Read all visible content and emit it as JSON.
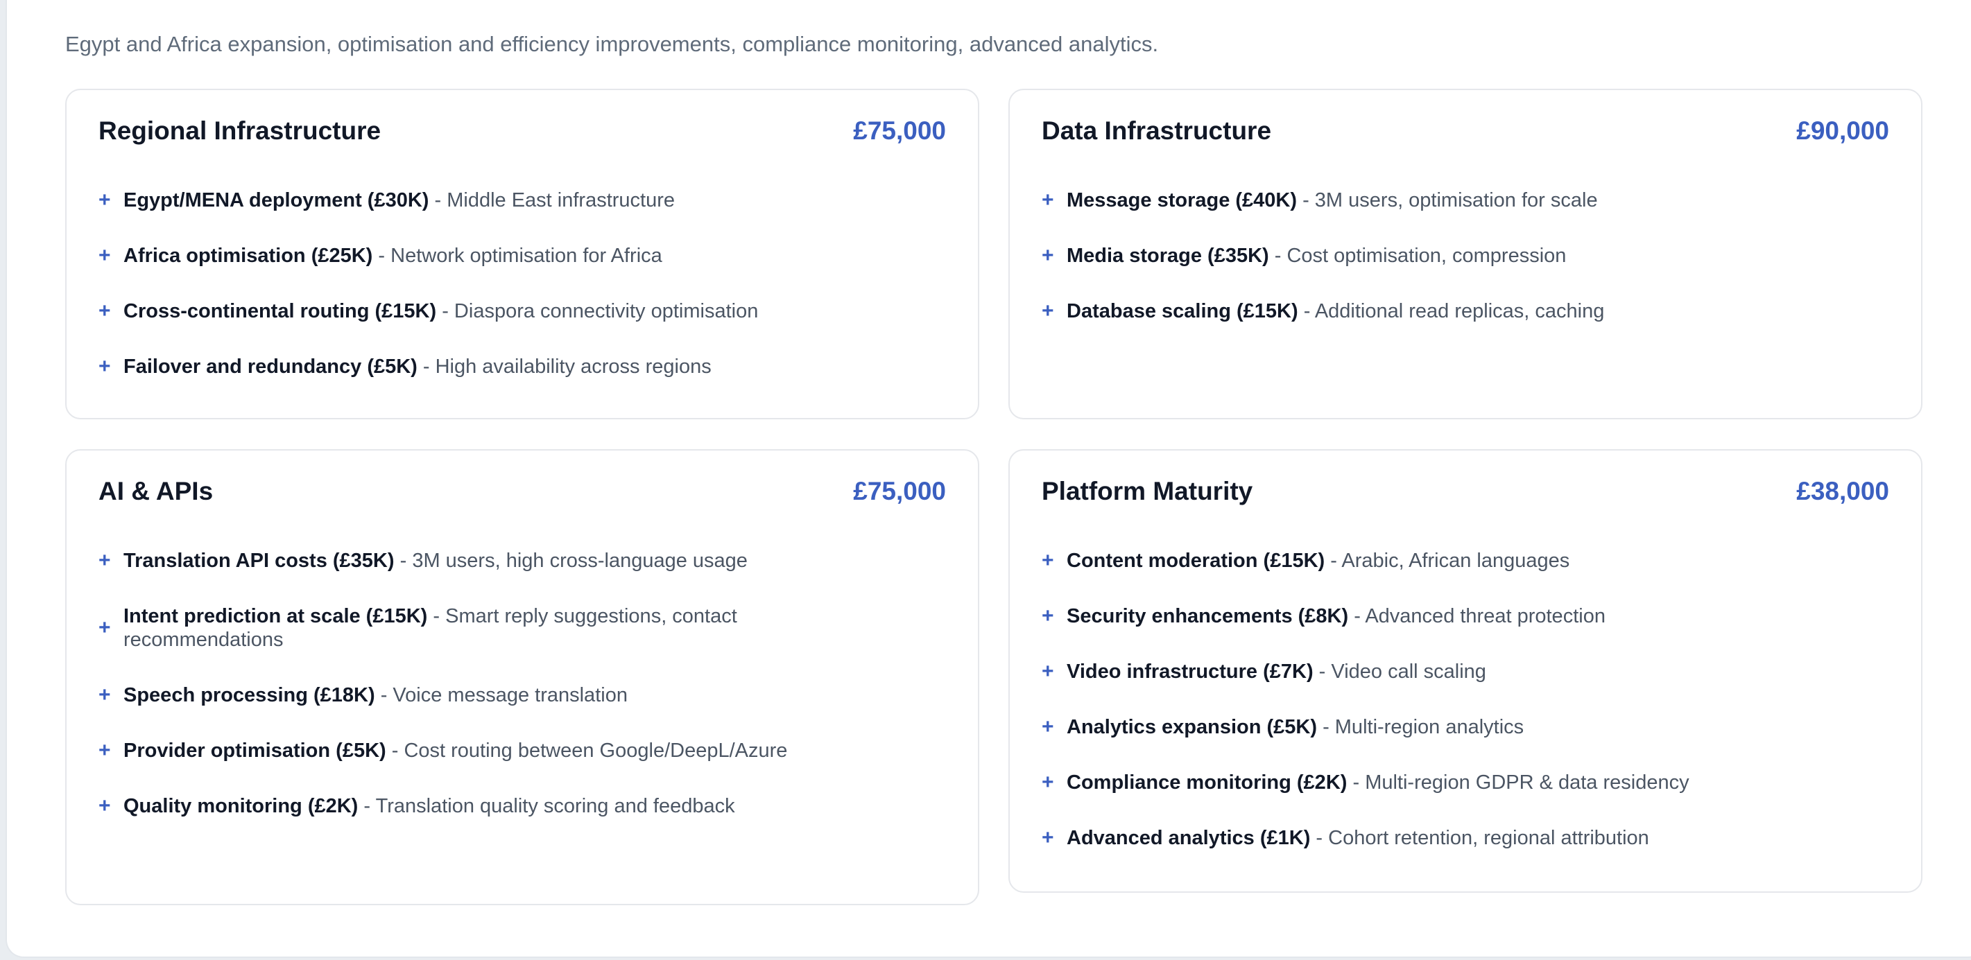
{
  "section": {
    "heading": "",
    "subtitle": "Egypt and Africa expansion, optimisation and efficiency improvements, compliance monitoring, advanced analytics."
  },
  "colors": {
    "accent": "#3b5fc0",
    "text": "#111827",
    "muted": "#4b5563",
    "border": "#e5e7eb"
  },
  "cards": [
    {
      "title": "Regional Infrastructure",
      "amount": "£75,000",
      "items": [
        {
          "name": "Egypt/MENA deployment (£30K)",
          "desc": "- Middle East infrastructure"
        },
        {
          "name": "Africa optimisation (£25K)",
          "desc": "- Network optimisation for Africa"
        },
        {
          "name": "Cross-continental routing (£15K)",
          "desc": "- Diaspora connectivity optimisation"
        },
        {
          "name": "Failover and redundancy (£5K)",
          "desc": "- High availability across regions"
        }
      ]
    },
    {
      "title": "Data Infrastructure",
      "amount": "£90,000",
      "items": [
        {
          "name": "Message storage (£40K)",
          "desc": "- 3M users, optimisation for scale"
        },
        {
          "name": "Media storage (£35K)",
          "desc": "- Cost optimisation, compression"
        },
        {
          "name": "Database scaling (£15K)",
          "desc": "- Additional read replicas, caching"
        }
      ]
    },
    {
      "title": "AI & APIs",
      "amount": "£75,000",
      "items": [
        {
          "name": "Translation API costs (£35K)",
          "desc": "- 3M users, high cross-language usage"
        },
        {
          "name": "Intent prediction at scale (£15K)",
          "desc": "- Smart reply suggestions, contact recommendations"
        },
        {
          "name": "Speech processing (£18K)",
          "desc": "- Voice message translation"
        },
        {
          "name": "Provider optimisation (£5K)",
          "desc": "- Cost routing between Google/DeepL/Azure"
        },
        {
          "name": "Quality monitoring (£2K)",
          "desc": "- Translation quality scoring and feedback"
        }
      ]
    },
    {
      "title": "Platform Maturity",
      "amount": "£38,000",
      "items": [
        {
          "name": "Content moderation (£15K)",
          "desc": "- Arabic, African languages"
        },
        {
          "name": "Security enhancements (£8K)",
          "desc": "- Advanced threat protection"
        },
        {
          "name": "Video infrastructure (£7K)",
          "desc": "- Video call scaling"
        },
        {
          "name": "Analytics expansion (£5K)",
          "desc": "- Multi-region analytics"
        },
        {
          "name": "Compliance monitoring (£2K)",
          "desc": "- Multi-region GDPR & data residency"
        },
        {
          "name": "Advanced analytics (£1K)",
          "desc": "- Cohort retention, regional attribution"
        }
      ]
    }
  ]
}
